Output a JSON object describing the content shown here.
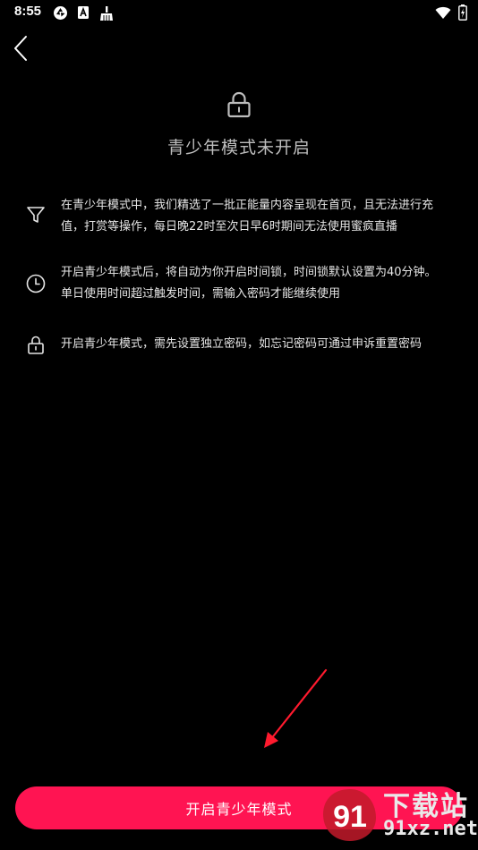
{
  "status_bar": {
    "time": "8:55",
    "left_icons": [
      "aperture-icon",
      "app-a-icon",
      "broom-icon"
    ],
    "right_icons": [
      "wifi-icon",
      "battery-charging-icon"
    ]
  },
  "header": {
    "back_icon": "chevron-left-icon"
  },
  "hero": {
    "icon": "lock-icon",
    "title": "青少年模式未开启"
  },
  "features": [
    {
      "icon": "filter-icon",
      "lines": [
        "在青少年模式中，我们精选了一批正能量内容呈现在首页，且无法进行充",
        "值，打赏等操作，每日晚22时至次日早6时期间无法使用蜜疯直播"
      ]
    },
    {
      "icon": "clock-icon",
      "lines": [
        "开启青少年模式后，将自动为你开启时间锁，时间锁默认设置为40分钟。",
        "单日使用时间超过触发时间，需输入密码才能继续使用"
      ]
    },
    {
      "icon": "lock-icon",
      "lines": [
        "开启青少年模式，需先设置独立密码，如忘记密码可通过申诉重置密码"
      ]
    }
  ],
  "action": {
    "button_label": "开启青少年模式"
  },
  "watermark": {
    "cn": "下载站",
    "url": "91xz.net"
  },
  "colors": {
    "background": "#000000",
    "accent": "#ff1452",
    "annotation_arrow": "#ff1a2e"
  }
}
